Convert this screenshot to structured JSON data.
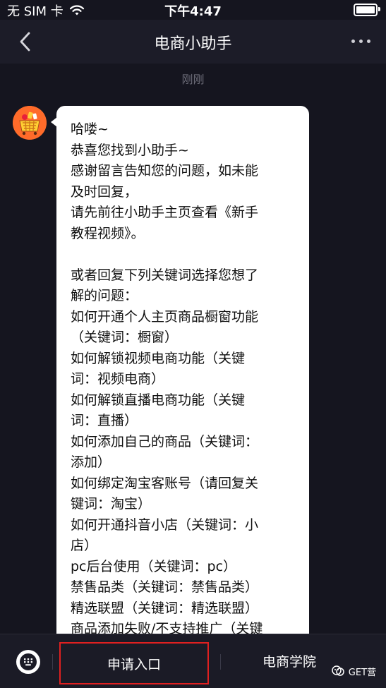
{
  "status_bar": {
    "carrier": "无 SIM 卡",
    "time": "下午4:47"
  },
  "nav": {
    "title": "电商小助手"
  },
  "chat": {
    "timestamp": "刚刚",
    "message_lines": [
      "哈喽~",
      "恭喜您找到小助手~",
      "感谢留言告知您的问题，如未能",
      "及时回复，",
      "请先前往小助手主页查看《新手",
      "教程视频》。",
      "",
      "或者回复下列关键词选择您想了",
      "解的问题：",
      "如何开通个人主页商品橱窗功能",
      "（关键词：橱窗）",
      "如何解锁视频电商功能（关键",
      "词：视频电商）",
      "如何解锁直播电商功能（关键",
      "词：直播）",
      "如何添加自己的商品（关键词：",
      "添加）",
      "如何绑定淘宝客账号（请回复关",
      "键词：淘宝）",
      "如何开通抖音小店（关键词：小",
      "店）",
      "pc后台使用（关键词：pc）",
      "禁售品类（关键词：禁售品类）",
      "精选联盟（关键词：精选联盟）",
      "商品添加失败/不支持推广（关键"
    ]
  },
  "bottom_menu": {
    "apply_label": "申请入口",
    "academy_label": "电商学院",
    "highlight_color": "#e02020"
  },
  "watermark": {
    "text": "GET营"
  },
  "icons": [
    "wifi-icon",
    "battery-icon",
    "back-icon",
    "more-icon",
    "avatar",
    "keyboard-icon",
    "watermark-logo-icon"
  ]
}
